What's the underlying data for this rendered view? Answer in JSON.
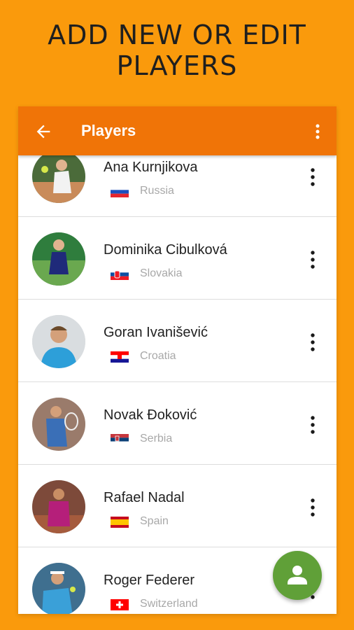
{
  "promo": {
    "title_line1": "ADD NEW OR EDIT",
    "title_line2": "PLAYERS"
  },
  "appbar": {
    "title": "Players",
    "back_icon": "arrow-left-icon",
    "menu_icon": "more-vert-icon",
    "color": "#F07407"
  },
  "players": [
    {
      "name": "Ana Kurnjikova",
      "country": "Russia",
      "flag": "russia-flag"
    },
    {
      "name": "Dominika Cibulková",
      "country": "Slovakia",
      "flag": "slovakia-flag"
    },
    {
      "name": "Goran Ivanišević",
      "country": "Croatia",
      "flag": "croatia-flag"
    },
    {
      "name": "Novak Đoković",
      "country": "Serbia",
      "flag": "serbia-flag"
    },
    {
      "name": "Rafael Nadal",
      "country": "Spain",
      "flag": "spain-flag"
    },
    {
      "name": "Roger Federer",
      "country": "Switzerland",
      "flag": "switzerland-flag"
    }
  ],
  "fab": {
    "icon": "add-person-icon",
    "color": "#60A038"
  },
  "colors": {
    "background": "#FA9A0C",
    "appbar": "#F07407",
    "fab": "#60A038"
  }
}
